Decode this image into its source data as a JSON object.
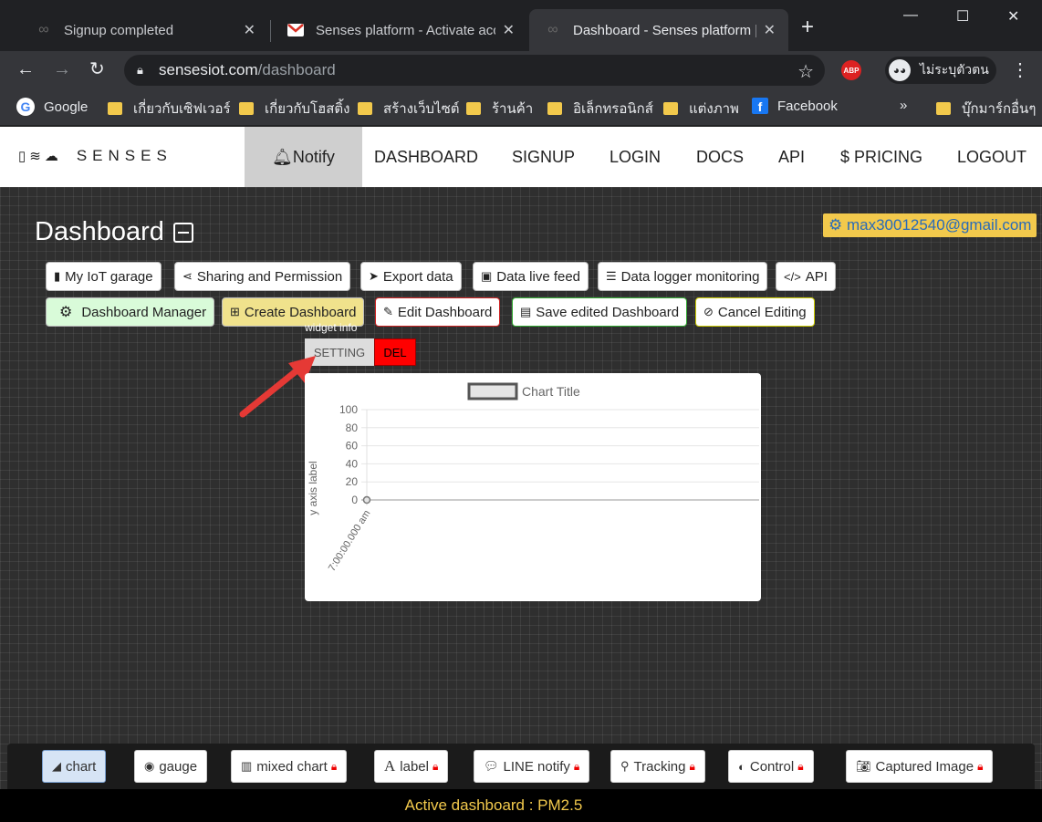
{
  "browser": {
    "tabs": [
      {
        "title": "Signup completed"
      },
      {
        "title": "Senses platform - Activate acco"
      },
      {
        "title": "Dashboard - Senses platform |"
      }
    ],
    "url_host": "sensesiot.com",
    "url_path": "/dashboard",
    "profile_label": "ไม่ระบุตัวตน",
    "abp_label": "ABP",
    "bookmarks": [
      {
        "label": "Google"
      },
      {
        "label": "เกี่ยวกับเซิฟเวอร์"
      },
      {
        "label": "เกี่ยวกับโฮสติ้ง"
      },
      {
        "label": "สร้างเว็บไซต์"
      },
      {
        "label": "ร้านค้า"
      },
      {
        "label": "อิเล็กทรอนิกส์"
      },
      {
        "label": "แต่งภาพ"
      },
      {
        "label": "Facebook"
      }
    ],
    "bookmark_more": "»",
    "other_bookmarks": "บุ๊กมาร์กอื่นๆ"
  },
  "site": {
    "brand": "SENSES",
    "nav": [
      {
        "label": "Notify"
      },
      {
        "label": "DASHBOARD"
      },
      {
        "label": "SIGNUP"
      },
      {
        "label": "LOGIN"
      },
      {
        "label": "DOCS"
      },
      {
        "label": "API"
      },
      {
        "label": "PRICING"
      },
      {
        "label": "LOGOUT"
      }
    ]
  },
  "dashboard": {
    "title": "Dashboard",
    "user_email": "max30012540@gmail.com",
    "row1": [
      {
        "label": "My IoT garage"
      },
      {
        "label": "Sharing and Permission"
      },
      {
        "label": "Export data"
      },
      {
        "label": "Data live feed"
      },
      {
        "label": "Data logger monitoring"
      },
      {
        "label": "API"
      }
    ],
    "row2": [
      {
        "label": "Dashboard Manager"
      },
      {
        "label": "Create Dashboard"
      },
      {
        "label": "Edit Dashboard"
      },
      {
        "label": "Save edited Dashboard"
      },
      {
        "label": "Cancel Editing"
      }
    ],
    "widget_info": "widget info",
    "setting_label": "SETTING",
    "del_label": "DEL"
  },
  "chart_data": {
    "type": "line",
    "title": "Chart Title",
    "ylabel": "y axis label",
    "xlabel": "",
    "ylim": [
      0,
      100
    ],
    "yticks": [
      "100",
      "80",
      "60",
      "40",
      "20",
      "0"
    ],
    "x": [
      "7:00:00.000 am"
    ],
    "series": [
      {
        "values": [
          0
        ]
      }
    ]
  },
  "toolbar": [
    {
      "label": "chart"
    },
    {
      "label": "gauge"
    },
    {
      "label": "mixed chart"
    },
    {
      "label": "label"
    },
    {
      "label": "LINE notify"
    },
    {
      "label": "Tracking"
    },
    {
      "label": "Control"
    },
    {
      "label": "Captured Image"
    }
  ],
  "footer": "Active dashboard : PM2.5"
}
